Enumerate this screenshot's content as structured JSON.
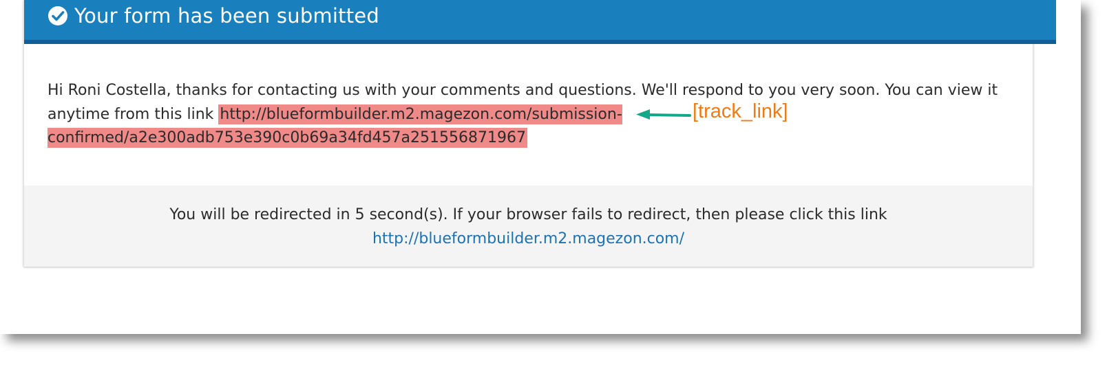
{
  "header": {
    "title": "Your form has been submitted",
    "icon": "check-circle-icon",
    "color": "#1a80bd"
  },
  "body": {
    "message": "Hi Roni Costella, thanks for contacting us with your comments and questions. We'll respond to you very soon. You can view it anytime from this link",
    "track_link": "http://blueformbuilder.m2.magezon.com/submission-confirmed/a2e300adb753e390c0b69a34fd457a251556871967",
    "highlight_color": "#f08a89"
  },
  "footer": {
    "redirect_text": "You will be redirected in 5 second(s). If your browser fails to redirect, then please click this link",
    "redirect_link": "http://blueformbuilder.m2.magezon.com/",
    "link_color": "#1a73b7"
  },
  "annotation": {
    "label": "[track_link]",
    "label_color": "#f07b14",
    "arrow_color": "#13a88a",
    "arrow_icon": "left-arrow-icon"
  }
}
